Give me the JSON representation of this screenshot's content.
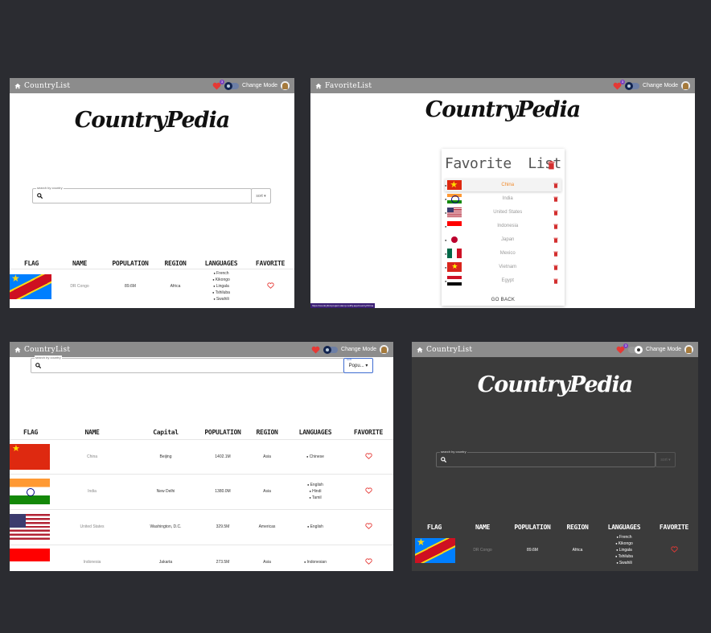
{
  "appbar": {
    "home_title_list": "CountryList",
    "home_title_fav": "FavoriteList",
    "change_mode": "Change Mode",
    "fav_badge_count": "3"
  },
  "logo": "CountryPedia",
  "search": {
    "label": "search by country",
    "sort_label": "sort",
    "sort_value": "Popu...",
    "sort_caption": "sort"
  },
  "table_headers_home": [
    "FLAG",
    "NAME",
    "POPULATION",
    "REGION",
    "LANGUAGES",
    "FAVORITE"
  ],
  "table_headers_sorted": [
    "FLAG",
    "NAME",
    "Capital",
    "POPULATION",
    "REGION",
    "LANGUAGES",
    "FAVORITE"
  ],
  "drc": {
    "name": "DR Congo",
    "population": "89.6M",
    "region": "Africa",
    "languages": [
      "French",
      "Kikongo",
      "Lingala",
      "Tshiluba",
      "Swahili"
    ]
  },
  "sorted_rows": [
    {
      "name": "China",
      "capital": "Beijing",
      "population": "1402.1M",
      "region": "Asia",
      "languages": [
        "Chinese"
      ]
    },
    {
      "name": "India",
      "capital": "New Delhi",
      "population": "1380.0M",
      "region": "Asia",
      "languages": [
        "English",
        "Hindi",
        "Tamil"
      ]
    },
    {
      "name": "United States",
      "capital": "Washington, D.C.",
      "population": "329.5M",
      "region": "Americas",
      "languages": [
        "English"
      ]
    },
    {
      "name": "Indonesia",
      "capital": "Jakarta",
      "population": "273.5M",
      "region": "Asia",
      "languages": [
        "Indonesian"
      ]
    }
  ],
  "favorites": {
    "title_left": "Favorite",
    "title_right": "List",
    "items": [
      "China",
      "India",
      "United States",
      "Indonesia",
      "Japan",
      "Mexico",
      "Vietnam",
      "Egypt"
    ],
    "go_back": "GO BACK",
    "status_url": "https://countryfind.project.stamp.netlify.app/country/China"
  },
  "colors": {
    "appbar": "#8c8c8c",
    "accent_orange": "#f08a2a",
    "heart_red": "#e53935",
    "dark_bg": "#3b3b3b"
  }
}
